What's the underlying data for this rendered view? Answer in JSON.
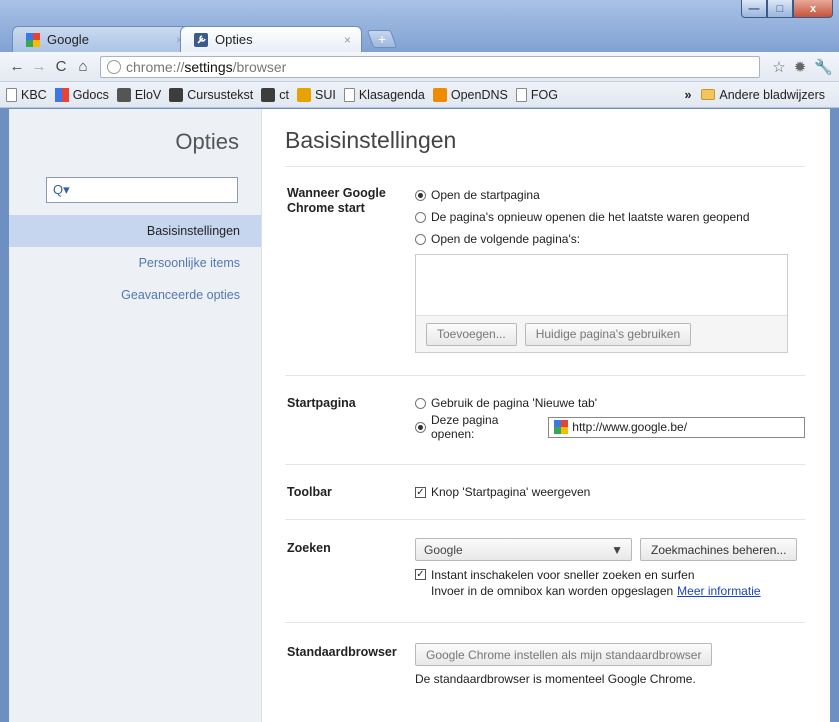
{
  "window": {
    "min_label": "—",
    "max_label": "□",
    "close_label": "x"
  },
  "tabs": [
    {
      "title": "Google",
      "close": "×"
    },
    {
      "title": "Opties",
      "close": "×"
    }
  ],
  "newtab_label": "+",
  "omnibox": {
    "prefix": "chrome://",
    "strong": "settings",
    "suffix": "/browser"
  },
  "bookmarks": [
    "KBC",
    "Gdocs",
    "EloV",
    "Cursustekst",
    "ct",
    "SUI",
    "Klasagenda",
    "OpenDNS",
    "FOG"
  ],
  "bookmarks_chevron": "»",
  "other_bookmarks": "Andere bladwijzers",
  "sidebar": {
    "title": "Opties",
    "search_placeholder": "",
    "items": [
      "Basisinstellingen",
      "Persoonlijke items",
      "Geavanceerde opties"
    ]
  },
  "main": {
    "title": "Basisinstellingen",
    "startup": {
      "label": "Wanneer Google Chrome start",
      "opt1": "Open de startpagina",
      "opt2": "De pagina's opnieuw openen die het laatste waren geopend",
      "opt3": "Open de volgende pagina's:",
      "add_button": "Toevoegen...",
      "use_current_button": "Huidige pagina's gebruiken"
    },
    "homepage": {
      "label": "Startpagina",
      "opt1": "Gebruik de pagina 'Nieuwe tab'",
      "opt2": "Deze pagina openen:",
      "url": "http://www.google.be/"
    },
    "toolbar": {
      "label": "Toolbar",
      "show_home": "Knop 'Startpagina' weergeven"
    },
    "search": {
      "label": "Zoeken",
      "engine": "Google",
      "manage_button": "Zoekmachines beheren...",
      "instant": "Instant inschakelen voor sneller zoeken en surfen",
      "note": "Invoer in de omnibox kan worden opgeslagen",
      "more_info": "Meer informatie"
    },
    "default_browser": {
      "label": "Standaardbrowser",
      "button": "Google Chrome instellen als mijn standaardbrowser",
      "status": "De standaardbrowser is momenteel Google Chrome."
    }
  }
}
